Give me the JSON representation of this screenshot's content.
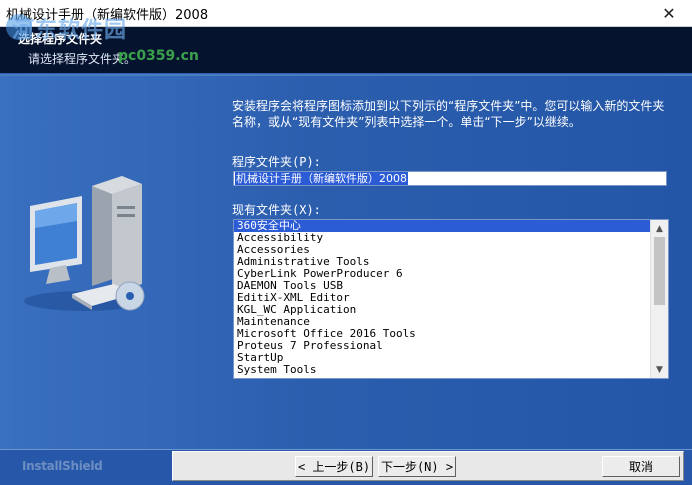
{
  "window": {
    "title": "机械设计手册（新编软件版）2008",
    "close_glyph": "✕"
  },
  "header": {
    "title": "选择程序文件夹",
    "subtitle": "请选择程序文件夹。"
  },
  "watermark": {
    "text": "河东软件园",
    "url": "pc0359.cn"
  },
  "main": {
    "intro": "安装程序会将程序图标添加到以下列示的“程序文件夹”中。您可以输入新的文件夹名称，或从“现有文件夹”列表中选择一个。单击“下一步”以继续。",
    "program_folder_label": "程序文件夹(P):",
    "program_folder_value": "机械设计手册（新编软件版）2008",
    "existing_folders_label": "现有文件夹(X):",
    "existing_folders": [
      "360安全中心",
      "Accessibility",
      "Accessories",
      "Administrative Tools",
      "CyberLink PowerProducer 6",
      "DAEMON Tools USB",
      "EditiX-XML Editor",
      "KGL_WC Application",
      "Maintenance",
      "Microsoft Office 2016 Tools",
      "Proteus 7 Professional",
      "StartUp",
      "System Tools"
    ],
    "selected_index": 0
  },
  "footer": {
    "brand": "InstallShield",
    "back_button": "< 上一步(B)",
    "next_button": "下一步(N) >",
    "cancel_button": "取消"
  },
  "colors": {
    "accent": "#2c5bd6",
    "panel": "#2a5fb0",
    "header": "#05132f"
  }
}
